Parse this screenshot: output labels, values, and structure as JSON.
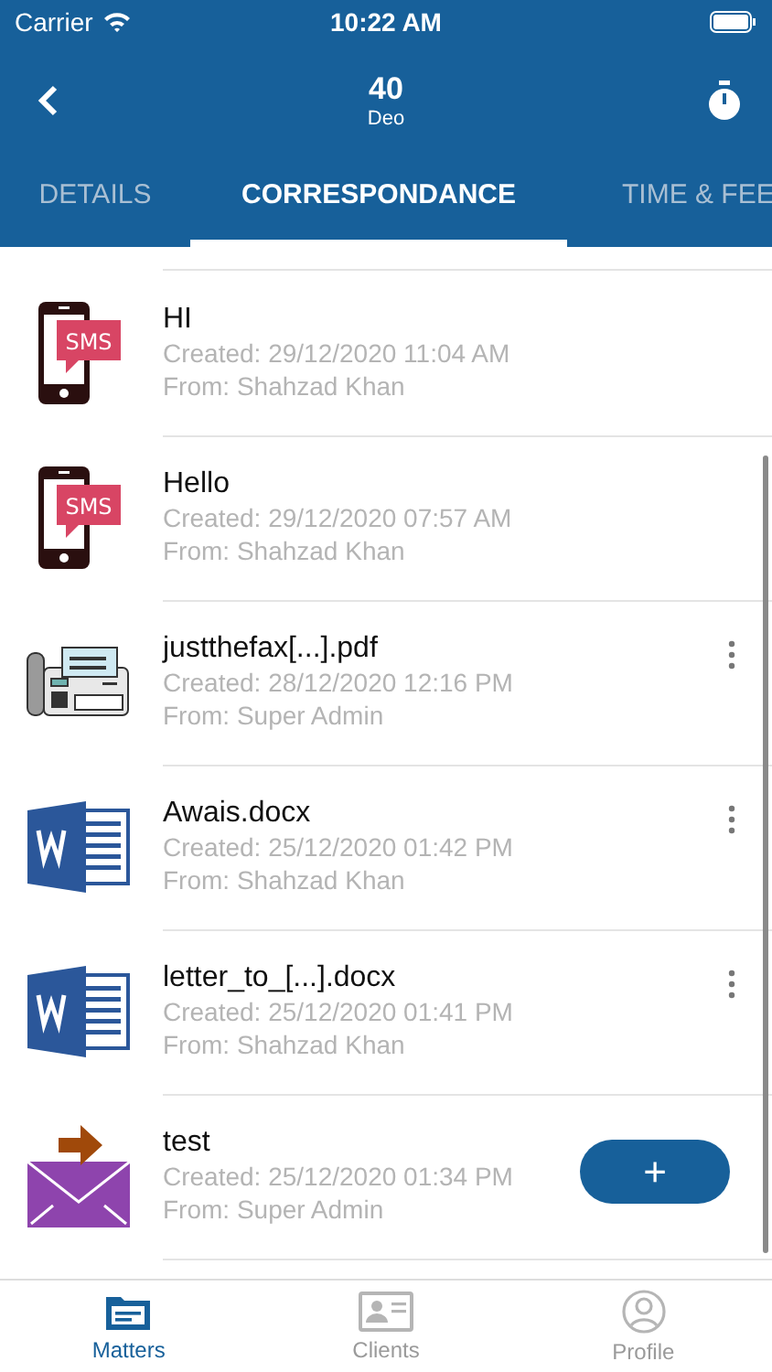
{
  "status_bar": {
    "carrier": "Carrier",
    "time": "10:22 AM"
  },
  "header": {
    "title": "40",
    "subtitle": "Deo"
  },
  "tabs": [
    {
      "label": "DETAILS",
      "selected": false
    },
    {
      "label": "CORRESPONDANCE",
      "selected": true
    },
    {
      "label": "TIME & FEE",
      "selected": false
    }
  ],
  "items": [
    {
      "kind": "sms",
      "badge": "SMS",
      "title": "HI",
      "created": "Created: 29/12/2020 11:04 AM",
      "from": "From: Shahzad Khan",
      "menu": false
    },
    {
      "kind": "sms",
      "badge": "SMS",
      "title": "Hello",
      "created": "Created: 29/12/2020 07:57 AM",
      "from": "From: Shahzad Khan",
      "menu": false
    },
    {
      "kind": "fax",
      "title": "justthefax[...].pdf",
      "created": "Created: 28/12/2020 12:16 PM",
      "from": "From: Super Admin",
      "menu": true
    },
    {
      "kind": "word",
      "title": "Awais.docx",
      "created": "Created: 25/12/2020 01:42 PM",
      "from": "From: Shahzad Khan",
      "menu": true
    },
    {
      "kind": "word",
      "title": "letter_to_[...].docx",
      "created": "Created: 25/12/2020 01:41 PM",
      "from": "From: Shahzad Khan",
      "menu": true
    },
    {
      "kind": "email",
      "title": "test",
      "created": "Created: 25/12/2020 01:34 PM",
      "from": "From: Super Admin",
      "menu": false
    }
  ],
  "fab": {
    "label": "+"
  },
  "nav": [
    {
      "kind": "matters",
      "label": "Matters",
      "selected": true
    },
    {
      "kind": "clients",
      "label": "Clients",
      "selected": false
    },
    {
      "kind": "profile",
      "label": "Profile",
      "selected": false
    }
  ]
}
